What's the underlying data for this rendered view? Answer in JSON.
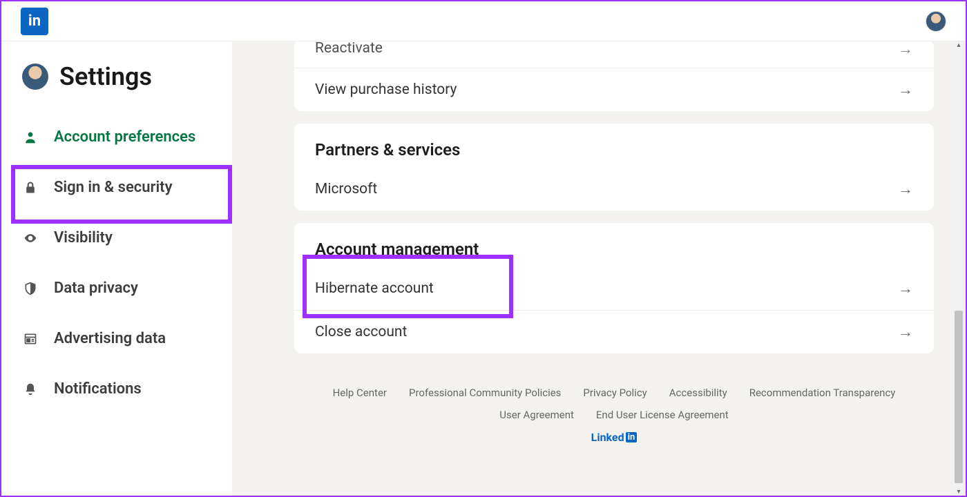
{
  "header": {
    "logo_text": "in"
  },
  "sidebar": {
    "title": "Settings",
    "items": [
      {
        "label": "Account preferences"
      },
      {
        "label": "Sign in & security"
      },
      {
        "label": "Visibility"
      },
      {
        "label": "Data privacy"
      },
      {
        "label": "Advertising data"
      },
      {
        "label": "Notifications"
      }
    ]
  },
  "main": {
    "top_card": {
      "rows": [
        {
          "label": "Reactivate"
        },
        {
          "label": "View purchase history"
        }
      ]
    },
    "partners": {
      "title": "Partners & services",
      "rows": [
        {
          "label": "Microsoft"
        }
      ]
    },
    "management": {
      "title": "Account management",
      "rows": [
        {
          "label": "Hibernate account"
        },
        {
          "label": "Close account"
        }
      ]
    }
  },
  "footer": {
    "links_row1": [
      "Help Center",
      "Professional Community Policies",
      "Privacy Policy",
      "Accessibility",
      "Recommendation Transparency"
    ],
    "links_row2": [
      "User Agreement",
      "End User License Agreement"
    ],
    "brand": "Linked"
  }
}
